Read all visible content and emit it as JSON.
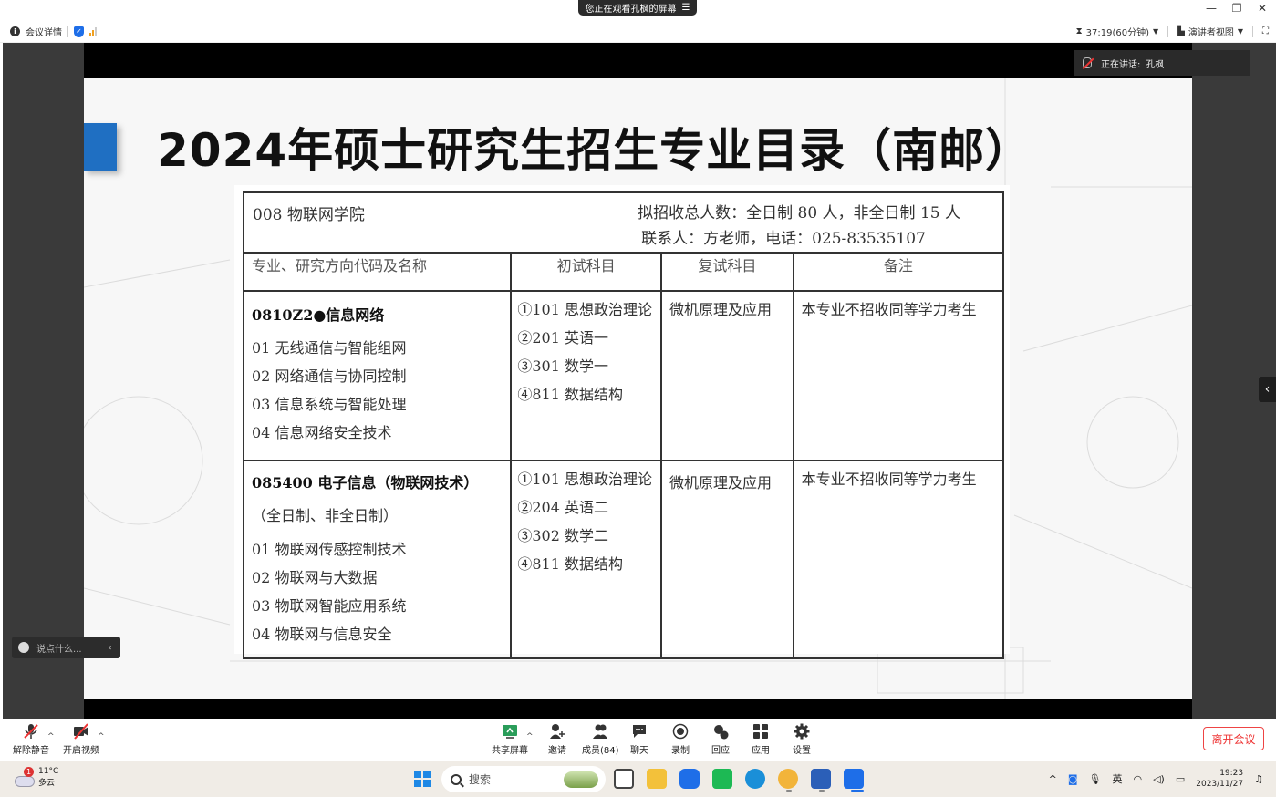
{
  "titlebar": {
    "watching_text": "您正在观看孔枫的屏幕",
    "menu_glyph": "☰",
    "minimize": "—",
    "restore": "❐",
    "close": "✕"
  },
  "infobar": {
    "meeting_details": "会议详情",
    "timer": "37:19(60分钟)",
    "view_mode": "演讲者视图"
  },
  "speaking": {
    "label": "正在讲话:",
    "name": "孔枫"
  },
  "slide": {
    "title": "2024年硕士研究生招生专业目录（南邮）",
    "college": "008 物联网学院",
    "recruit_line1": "拟招收总人数：全日制 80 人，非全日制 15 人",
    "recruit_line2": "联系人：方老师，电话：025-83535107",
    "columns": [
      "专业、研究方向代码及名称",
      "初试科目",
      "复试科目",
      "备注"
    ],
    "majors": [
      {
        "title": "0810Z2●信息网络",
        "extra": "",
        "directions": [
          "01  无线通信与智能组网",
          "02  网络通信与协同控制",
          "03  信息系统与智能处理",
          "04  信息网络安全技术"
        ],
        "exams": [
          "①101 思想政治理论",
          "②201 英语一",
          "③301 数学一",
          "④811 数据结构"
        ],
        "retest": "微机原理及应用",
        "note": "本专业不招收同等学力考生"
      },
      {
        "title": "085400 电子信息（物联网技术）",
        "extra": "（全日制、非全日制）",
        "directions": [
          "01  物联网传感控制技术",
          "02  物联网与大数据",
          "03  物联网智能应用系统",
          "04  物联网与信息安全"
        ],
        "exams": [
          "①101 思想政治理论",
          "②204 英语二",
          "③302 数学二",
          "④811 数据结构"
        ],
        "retest": "微机原理及应用",
        "note": "本专业不招收同等学力考生"
      }
    ]
  },
  "chat": {
    "placeholder": "说点什么..."
  },
  "toolbar": {
    "unmute": "解除静音",
    "start_video": "开启视频",
    "share_screen": "共享屏幕",
    "invite": "邀请",
    "members": "成员(84)",
    "chat": "聊天",
    "record": "录制",
    "react": "回应",
    "apps": "应用",
    "settings": "设置",
    "leave": "离开会议"
  },
  "taskbar": {
    "temperature": "11°C",
    "weather": "多云",
    "weather_badge": "1",
    "search": "搜索",
    "ime": "英",
    "time": "19:23",
    "date": "2023/11/27"
  }
}
